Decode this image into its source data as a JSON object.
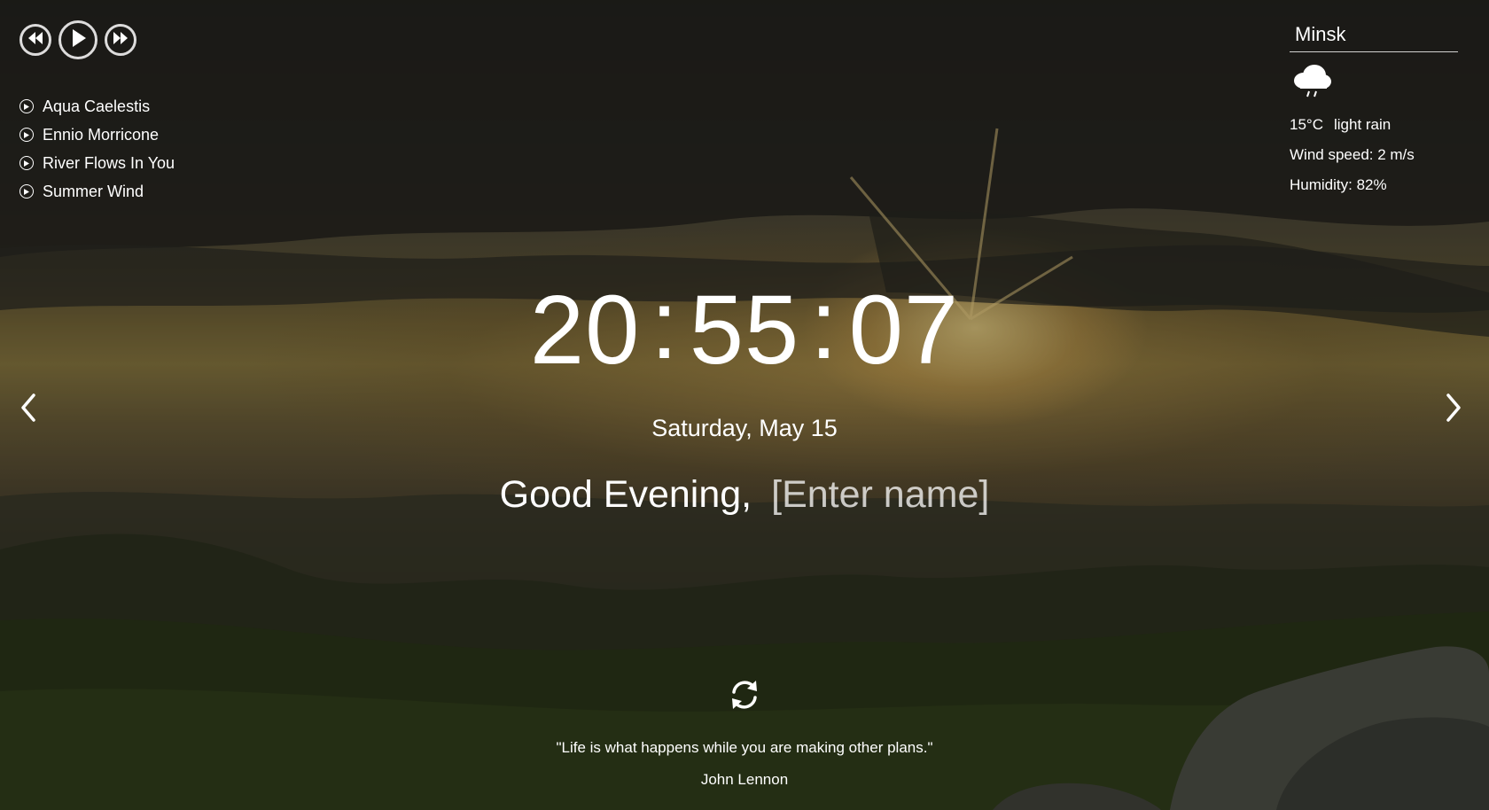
{
  "player": {
    "prev_icon": "rewind-icon",
    "play_icon": "play-icon",
    "next_icon": "fast-forward-icon",
    "tracks": [
      {
        "title": "Aqua Caelestis"
      },
      {
        "title": "Ennio Morricone"
      },
      {
        "title": "River Flows In You"
      },
      {
        "title": "Summer Wind"
      }
    ]
  },
  "weather": {
    "city": "Minsk",
    "icon": "rain-cloud-icon",
    "temperature": "15°C",
    "description": "light rain",
    "wind": "Wind speed: 2 m/s",
    "humidity": "Humidity: 82%"
  },
  "clock": {
    "hours": "20",
    "minutes": "55",
    "seconds": "07",
    "separator": ":",
    "date": "Saturday, May 15"
  },
  "greeting": {
    "text": "Good Evening,",
    "name_placeholder": "[Enter name]"
  },
  "slider": {
    "prev_icon": "chevron-left-icon",
    "next_icon": "chevron-right-icon"
  },
  "quote": {
    "refresh_icon": "refresh-icon",
    "text": "\"Life is what happens while you are making other plans.\"",
    "author": "John Lennon"
  },
  "colors": {
    "text": "#ffffff",
    "overlay": "rgba(0,0,0,0.28)"
  }
}
